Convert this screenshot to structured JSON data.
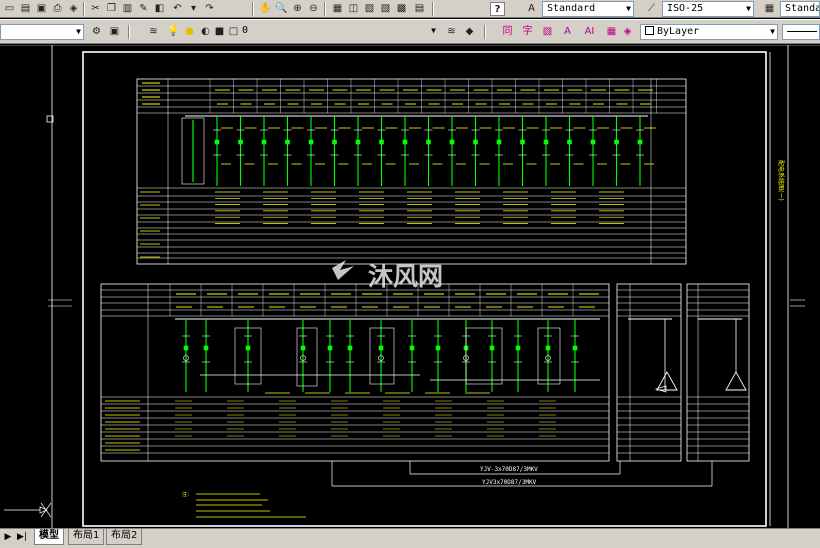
{
  "toolbar_top": {
    "text_style": "Standard",
    "dim_style": "ISO-25",
    "table_style": "Standa"
  },
  "toolbar_layers": {
    "layer_name": "0",
    "color": "ByLayer"
  },
  "drawing": {
    "watermark": "沐风网",
    "cable_1": "YJV-3x70D87/3MKV",
    "cable_2": "YJV3x70D87/3MKV"
  },
  "tabs": {
    "model": "模型",
    "layout1": "布局1",
    "layout2": "布局2"
  },
  "colors": {
    "line_white": "#ffffff",
    "line_green": "#00ff00",
    "text_yellow": "#ffff00",
    "toolbar_bg": "#d4d0c8"
  }
}
